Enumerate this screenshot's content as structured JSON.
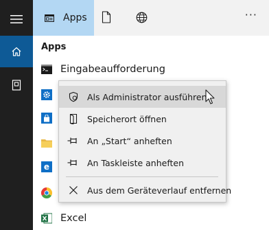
{
  "topbar": {
    "apps_tab_label": "Apps",
    "more_label": "···"
  },
  "section": {
    "title": "Apps"
  },
  "apps": [
    {
      "name": "Eingabeaufforderung",
      "icon": "command-prompt-icon"
    },
    {
      "name": "Excel",
      "icon": "excel-icon"
    }
  ],
  "context_menu": {
    "items": [
      {
        "label": "Als Administrator ausführen",
        "icon": "shield-icon"
      },
      {
        "label": "Speicherort öffnen",
        "icon": "open-file-location-icon"
      },
      {
        "label": "An „Start“ anheften",
        "icon": "pin-icon"
      },
      {
        "label": "An Taskleiste anheften",
        "icon": "pin-icon"
      },
      {
        "label": "Aus dem Geräteverlauf entfernen",
        "icon": "close-icon"
      }
    ]
  },
  "colors": {
    "rail": "#1f1f1f",
    "rail_active": "#0e5a96",
    "tab_active": "#b3d7f3",
    "menu_bg": "#f0f0f0",
    "menu_hover": "#d8d8d8"
  }
}
